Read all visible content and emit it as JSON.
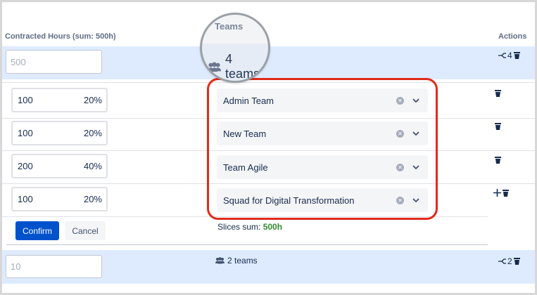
{
  "header": {
    "contracted_hours": "Contracted Hours (sum: 500h)",
    "teams": "Teams",
    "actions": "Actions"
  },
  "group1": {
    "hours_placeholder": "500",
    "teams_summary": "4 teams",
    "subgroup_count": "4"
  },
  "rows": [
    {
      "hours": "100",
      "percent": "20%",
      "team": "Admin Team"
    },
    {
      "hours": "100",
      "percent": "20%",
      "team": "New Team"
    },
    {
      "hours": "200",
      "percent": "40%",
      "team": "Team Agile"
    },
    {
      "hours": "100",
      "percent": "20%",
      "team": "Squad for Digital Transformation"
    }
  ],
  "footer": {
    "confirm_label": "Confirm",
    "cancel_label": "Cancel",
    "slices_sum_label": "Slices sum:",
    "slices_sum_value": "500h"
  },
  "group2": {
    "hours_placeholder": "10",
    "teams_summary": "2 teams",
    "subgroup_count": "2"
  },
  "colors": {
    "primary": "#0052cc",
    "highlight_band": "#deebff",
    "annotation_red": "#e02a1a",
    "sum_green": "#2e8b2e"
  },
  "icons": [
    "group-icon",
    "split-icon",
    "trash-icon",
    "clear-icon",
    "chevron-down-icon",
    "plus-icon"
  ]
}
